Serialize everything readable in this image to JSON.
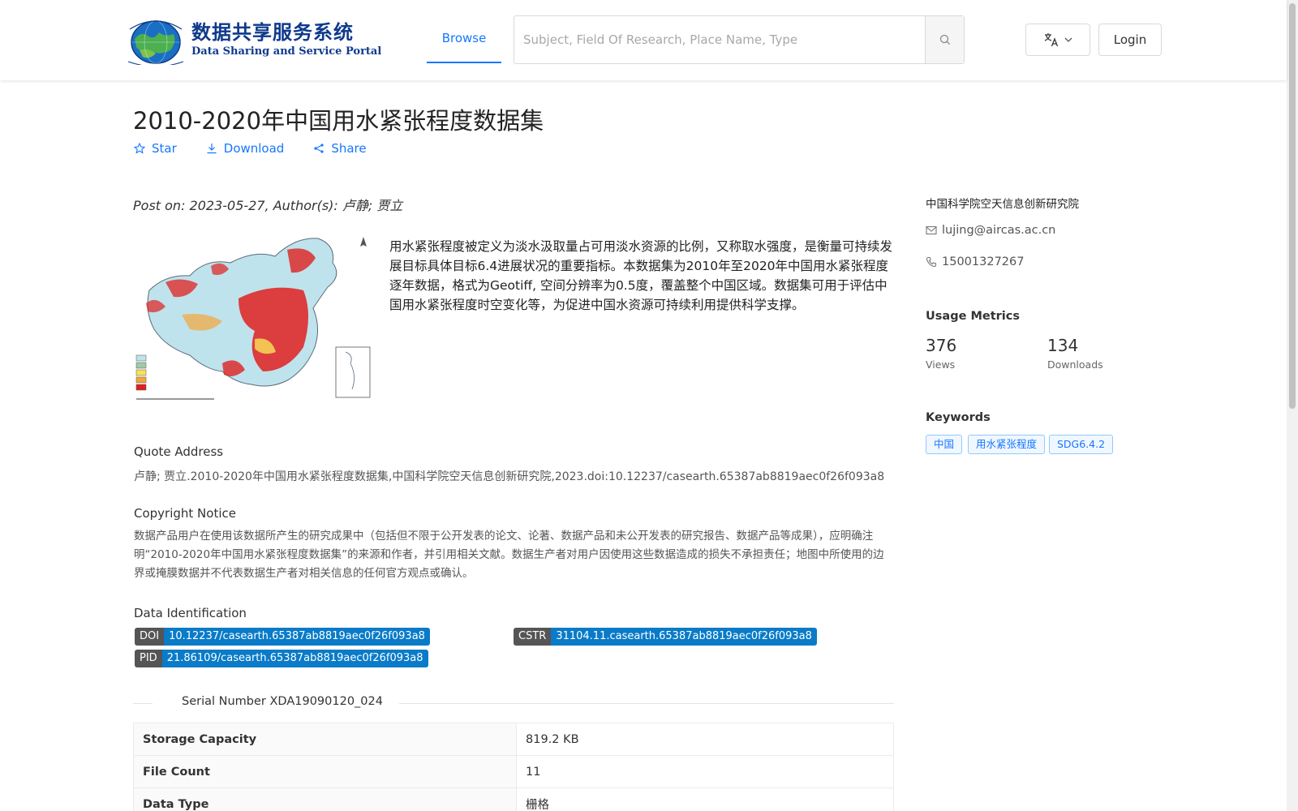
{
  "header": {
    "logo_cn": "数据共享服务系统",
    "logo_en": "Data Sharing and Service Portal",
    "nav_browse": "Browse",
    "search_placeholder": "Subject, Field Of Research, Place Name, Type",
    "login_label": "Login"
  },
  "dataset": {
    "title": "2010-2020年中国用水紧张程度数据集",
    "actions": {
      "star": "Star",
      "download": "Download",
      "share": "Share"
    },
    "post_on_label": "Post on:",
    "post_date": "2023-05-27",
    "authors_label": "Author(s):",
    "authors": "卢静; 贾立",
    "abstract": "用水紧张程度被定义为淡水汲取量占可用淡水资源的比例，又称取水强度，是衡量可持续发展目标具体目标6.4进展状况的重要指标。本数据集为2010年至2020年中国用水紧张程度逐年数据，格式为Geotiff, 空间分辨率为0.5度，覆盖整个中国区域。数据集可用于评估中国用水紧张程度时空变化等，为促进中国水资源可持续利用提供科学支撑。",
    "quote_label": "Quote Address",
    "quote_text": "卢静; 贾立.2010-2020年中国用水紧张程度数据集,中国科学院空天信息创新研究院,2023.doi:10.12237/casearth.65387ab8819aec0f26f093a8",
    "copyright_label": "Copyright Notice",
    "copyright_text": "数据产品用户在使用该数据所产生的研究成果中（包括但不限于公开发表的论文、论著、数据产品和未公开发表的研究报告、数据产品等成果），应明确注明“2010-2020年中国用水紧张程度数据集”的来源和作者，并引用相关文献。数据生产者对用户因使用这些数据造成的损失不承担责任；地图中所使用的边界或掩膜数据并不代表数据生产者对相关信息的任何官方观点或确认。",
    "identification_label": "Data Identification",
    "identifiers": {
      "doi_key": "DOI",
      "doi_value": "10.12237/casearth.65387ab8819aec0f26f093a8",
      "cstr_key": "CSTR",
      "cstr_value": "31104.11.casearth.65387ab8819aec0f26f093a8",
      "pid_key": "PID",
      "pid_value": "21.86109/casearth.65387ab8819aec0f26f093a8"
    },
    "serial_number": "Serial Number XDA19090120_024",
    "info_rows": [
      {
        "key": "Storage Capacity",
        "value": "819.2 KB"
      },
      {
        "key": "File Count",
        "value": "11"
      },
      {
        "key": "Data Type",
        "value": "栅格"
      }
    ]
  },
  "sidebar": {
    "organization": "中国科学院空天信息创新研究院",
    "email": "lujing@aircas.ac.cn",
    "phone": "15001327267",
    "usage_heading": "Usage Metrics",
    "views_count": "376",
    "views_label": "Views",
    "downloads_count": "134",
    "downloads_label": "Downloads",
    "keywords_heading": "Keywords",
    "keywords": [
      "中国",
      "用水紧张程度",
      "SDG6.4.2"
    ]
  },
  "colors": {
    "accent": "#1677ff",
    "tag_value_bg": "#0a7bc8",
    "tag_key_bg": "#555555",
    "logo_blue": "#0f3a8c"
  },
  "icons": [
    "search-icon",
    "translate-icon",
    "chevron-down-icon",
    "star-icon",
    "download-icon",
    "share-icon",
    "mail-icon",
    "phone-icon",
    "map-thumbnail"
  ]
}
